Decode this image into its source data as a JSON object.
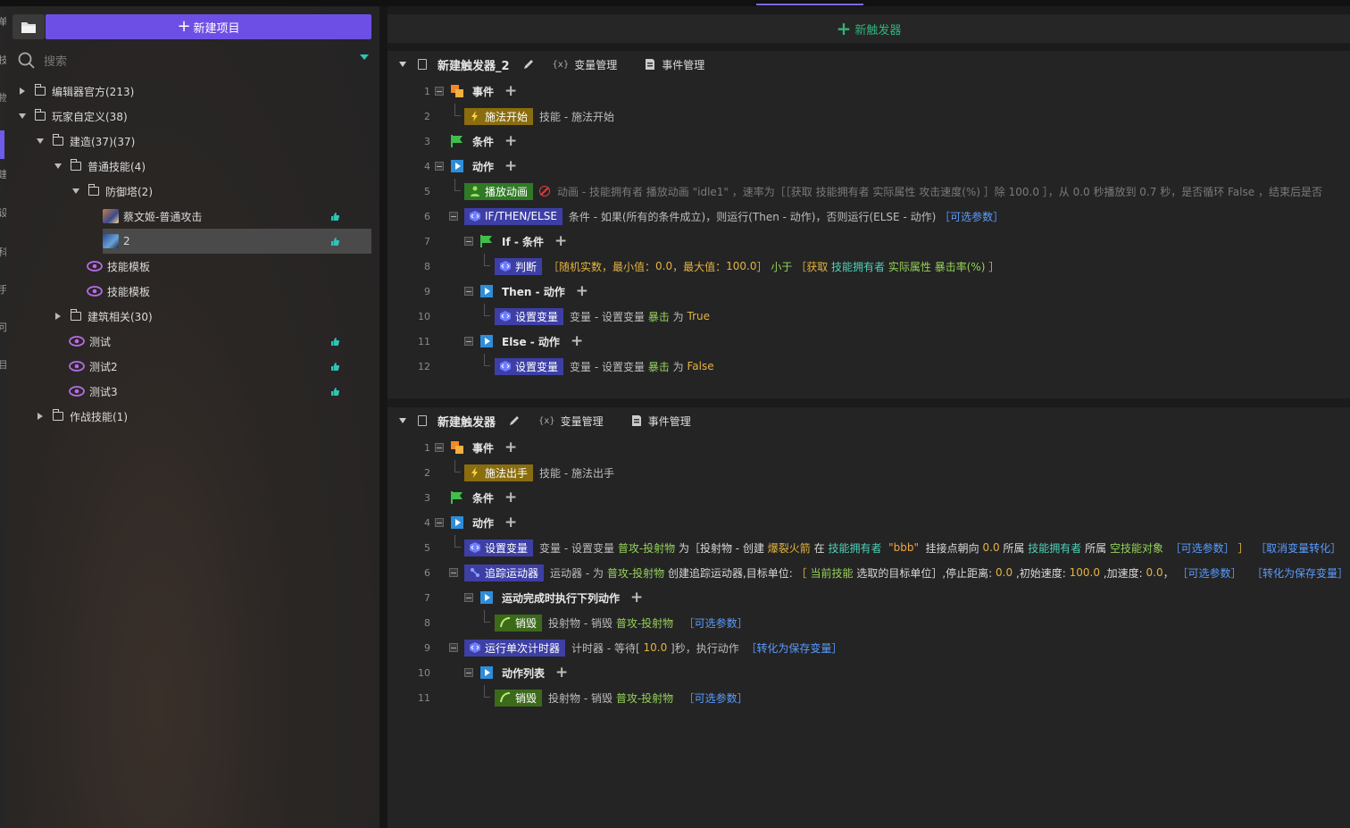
{
  "left": {
    "new_project": "新建项目",
    "search_placeholder": "搜索",
    "tree": {
      "editor_official": "编辑器官方(213)",
      "player_custom": "玩家自定义(38)",
      "build": "建造(37)(37)",
      "normal_skill": "普通技能(4)",
      "tower": "防御塔(2)",
      "skill_a": "蔡文姬-普通攻击",
      "skill_b": "2",
      "template1": "技能模板",
      "template2": "技能模板",
      "building": "建筑相关(30)",
      "test1": "测试",
      "test2": "测试2",
      "test3": "测试3",
      "combat": "作战技能(1)"
    }
  },
  "right": {
    "new_trigger": "新触发器",
    "trigger1": {
      "title": "新建触发器_2",
      "var_mgr": "变量管理",
      "event_mgr": "事件管理",
      "lines": {
        "n": [
          "1",
          "2",
          "3",
          "4",
          "5",
          "6",
          "7",
          "8",
          "9",
          "10",
          "11",
          "12"
        ],
        "event_label": "事件",
        "cast_start_tag": "施法开始",
        "cast_start_desc": "技能 - 施法开始",
        "cond_label": "条件",
        "action_label": "动作",
        "play_anim_tag": "播放动画",
        "play_anim_desc": "动画 - 技能拥有者 播放动画 \"idle1\" ，速率为［［获取 技能拥有者 实际属性 攻击速度(%) ］除 100.0 ］，从 0.0 秒播放到 0.7 秒，是否循环 False ，结束后是否",
        "ifthen_tag": "IF/THEN/ELSE",
        "ifthen_desc": "条件 - 如果(所有的条件成立)，则运行(Then - 动作)，否则运行(ELSE - 动作)",
        "ifthen_opt": "［可选参数］",
        "if_label": "If - 条件",
        "judge_tag": "判断",
        "judge_p1": "［随机实数，最小值：",
        "judge_v1": "0.0",
        "judge_p2": "，最大值：",
        "judge_v2": "100.0",
        "judge_p3": "］",
        "judge_less": "小于",
        "judge_p4": "［获取",
        "judge_owner": "技能拥有者",
        "judge_attr": "实际属性",
        "judge_crit": "暴击率(%)",
        "judge_p5": "］",
        "then_label": "Then - 动作",
        "set_var_tag": "设置变量",
        "setvar_pre": "变量 - 设置变量",
        "crit_var": "暴击",
        "setvar_as": "为",
        "true_val": "True",
        "else_label": "Else - 动作",
        "set_var_tag2": "设置变量",
        "setvar_pre2": "变量 - 设置变量",
        "crit_var2": "暴击",
        "setvar_as2": "为",
        "false_val": "False"
      }
    },
    "trigger2": {
      "title": "新建触发器",
      "var_mgr": "变量管理",
      "event_mgr": "事件管理",
      "lines": {
        "n": [
          "1",
          "2",
          "3",
          "4",
          "5",
          "6",
          "7",
          "8",
          "9",
          "10",
          "11"
        ],
        "event_label": "事件",
        "cast_tag": "施法出手",
        "cast_desc": "技能 - 施法出手",
        "cond_label": "条件",
        "action_label": "动作",
        "set_var_tag": "设置变量",
        "sv_pre": "变量 - 设置变量",
        "sv_var": "普攻-投射物",
        "sv_as": "为［投射物 - 创建",
        "sv_fire": "爆裂火箭",
        "sv_at": "在",
        "sv_owner": "技能拥有者",
        "sv_bbb": "\"bbb\"",
        "sv_mount": "挂接点朝向",
        "sv_zero": "0.0",
        "sv_belong": "所属",
        "sv_owner2": "技能拥有者",
        "sv_belong2": "所属",
        "sv_empty": "空技能对象",
        "sv_opt": "［可选参数］",
        "sv_close": "］",
        "sv_cancel": "［取消变量转化］",
        "track_tag": "追踪运动器",
        "tr_pre": "运动器 - 为",
        "tr_var": "普攻-投射物",
        "tr_mid": "创建追踪运动器,目标单位:",
        "tr_b1": "［",
        "tr_cur": "当前技能",
        "tr_sel": "选取的目标单位］,停止距离:",
        "tr_v1": "0.0",
        "tr_init": ",初始速度:",
        "tr_v2": "100.0",
        "tr_acc": ",加速度:",
        "tr_v3": "0.0",
        "tr_comma": "，",
        "tr_opt": "［可选参数］",
        "tr_save": "［转化为保存变量］",
        "done_label": "运动完成时执行下列动作",
        "destroy_tag": "销毁",
        "ds_pre": "投射物 - 销毁",
        "ds_var": "普攻-投射物",
        "ds_opt": "［可选参数］",
        "timer_tag": "运行单次计时器",
        "tm_pre": "计时器 - 等待[",
        "tm_val": "10.0",
        "tm_post": "]秒，执行动作",
        "tm_save": "［转化为保存变量］",
        "list_label": "动作列表",
        "destroy_tag2": "销毁",
        "ds_pre2": "投射物 - 销毁",
        "ds_var2": "普攻-投射物",
        "ds_opt2": "［可选参数］"
      }
    }
  },
  "colors": {
    "accent": "#6e4fe6",
    "add_trigger": "#2fb37a",
    "variable": "#95d15a",
    "owner": "#4fd0b8",
    "number": "#e3b341",
    "optional": "#5a9cff"
  }
}
